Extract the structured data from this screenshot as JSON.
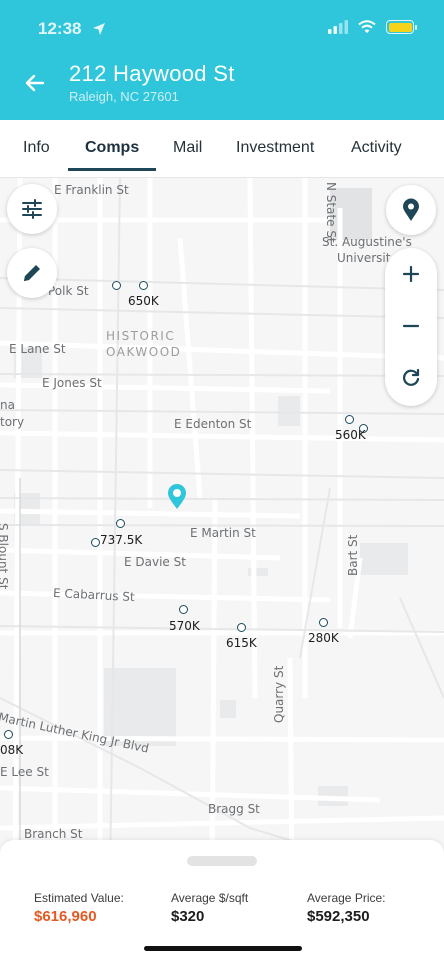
{
  "status_bar": {
    "time": "12:38",
    "battery_color": "#f6d31b"
  },
  "header": {
    "title": "212 Haywood St",
    "subtitle": "Raleigh, NC 27601",
    "bg_color": "#2fc6dc"
  },
  "tabs": [
    {
      "label": "Info",
      "active": false
    },
    {
      "label": "Comps",
      "active": true
    },
    {
      "label": "Mail",
      "active": false
    },
    {
      "label": "Investment",
      "active": false
    },
    {
      "label": "Activity",
      "active": false
    }
  ],
  "map": {
    "streets": [
      "E Franklin St",
      "N State St",
      "St. Augustine's",
      "Universit",
      "Polk St",
      "E Lane St",
      "E Jones St",
      "E Edenton St",
      "na",
      "tory",
      "E Martin St",
      "E Davie St",
      "S Blount St",
      "E Cabarrus St",
      "Bart St",
      "Quarry St",
      "Martin Luther King Jr Blvd",
      "E Lee St",
      "Bragg St",
      "Branch St"
    ],
    "district": [
      "HISTORIC",
      "OAKWOOD"
    ],
    "comps": [
      "650K",
      "560K",
      "737.5K",
      "570K",
      "615K",
      "280K",
      "08K"
    ],
    "pin_color": "#2fc6dc"
  },
  "controls": {
    "filter_icon": "sliders-icon",
    "edit_icon": "pencil-icon",
    "locate_icon": "location-pin-icon",
    "zoom_in_icon": "plus-icon",
    "zoom_out_icon": "minus-icon",
    "refresh_icon": "refresh-icon"
  },
  "summary": {
    "estimated_value_label": "Estimated Value:",
    "estimated_value": "$616,960",
    "avg_sqft_label": "Average $/sqft",
    "avg_sqft": "$320",
    "avg_price_label": "Average Price:",
    "avg_price": "$592,350",
    "accent_color": "#e25a24"
  }
}
